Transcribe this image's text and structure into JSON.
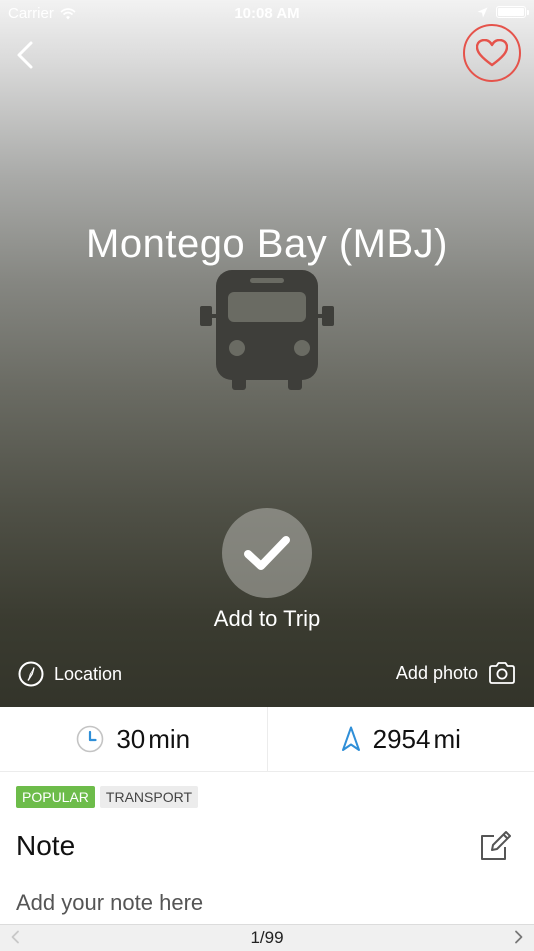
{
  "status_bar": {
    "carrier": "Carrier",
    "time": "10:08 AM",
    "battery_level": 1.0
  },
  "place": {
    "title": "Montego Bay (MBJ)",
    "icon": "bus-icon"
  },
  "actions": {
    "add_to_trip": "Add to Trip",
    "location": "Location",
    "add_photo": "Add photo"
  },
  "stats": {
    "duration_value": "30",
    "duration_unit": "min",
    "distance_value": "2954",
    "distance_unit": "mi"
  },
  "tags": [
    "POPULAR",
    "TRANSPORT"
  ],
  "note": {
    "heading": "Note",
    "placeholder": "Add your note here"
  },
  "pager": {
    "label": "1/99"
  },
  "colors": {
    "favorite": "#e5534b",
    "tag_popular": "#6dbc4a",
    "clock_icon": "#2f8fd8",
    "navigation_icon": "#2f8fd8"
  }
}
